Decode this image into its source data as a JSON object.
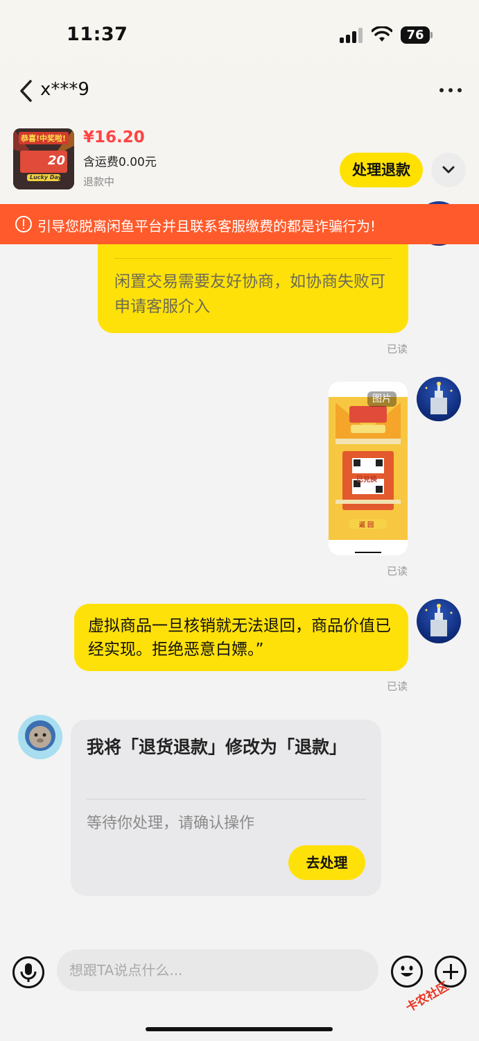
{
  "status_bar": {
    "time": "11:37",
    "battery": "76"
  },
  "nav": {
    "title": "x***9"
  },
  "product": {
    "price": "¥16.20",
    "shipping": "含运费0.00元",
    "status": "退款中",
    "handle_button": "处理退款",
    "image_banner": "恭喜!中奖啦!",
    "image_lucky": "Lucky Day",
    "image_number": "20"
  },
  "warning": {
    "text": "引导您脱离闲鱼平台并且联系客服缴费的都是诈骗行为!"
  },
  "messages": {
    "card1_text": "闲置交易需要友好协商，如协商失败可申请客服介入",
    "read1": "已读",
    "image_badge": "图片",
    "image_redeemed": "已兑换",
    "image_return": "返 回",
    "read2": "已读",
    "bubble_text": "虚拟商品一旦核销就无法退回，商品价值已经实现。拒绝恶意白嫖。”",
    "read3": "已读",
    "system_title": "我将「退货退款」修改为「退款」",
    "system_sub": "等待你处理，请确认操作",
    "system_button": "去处理"
  },
  "input_bar": {
    "placeholder": "想跟TA说点什么..."
  },
  "watermark": {
    "text": "卡农社区"
  }
}
